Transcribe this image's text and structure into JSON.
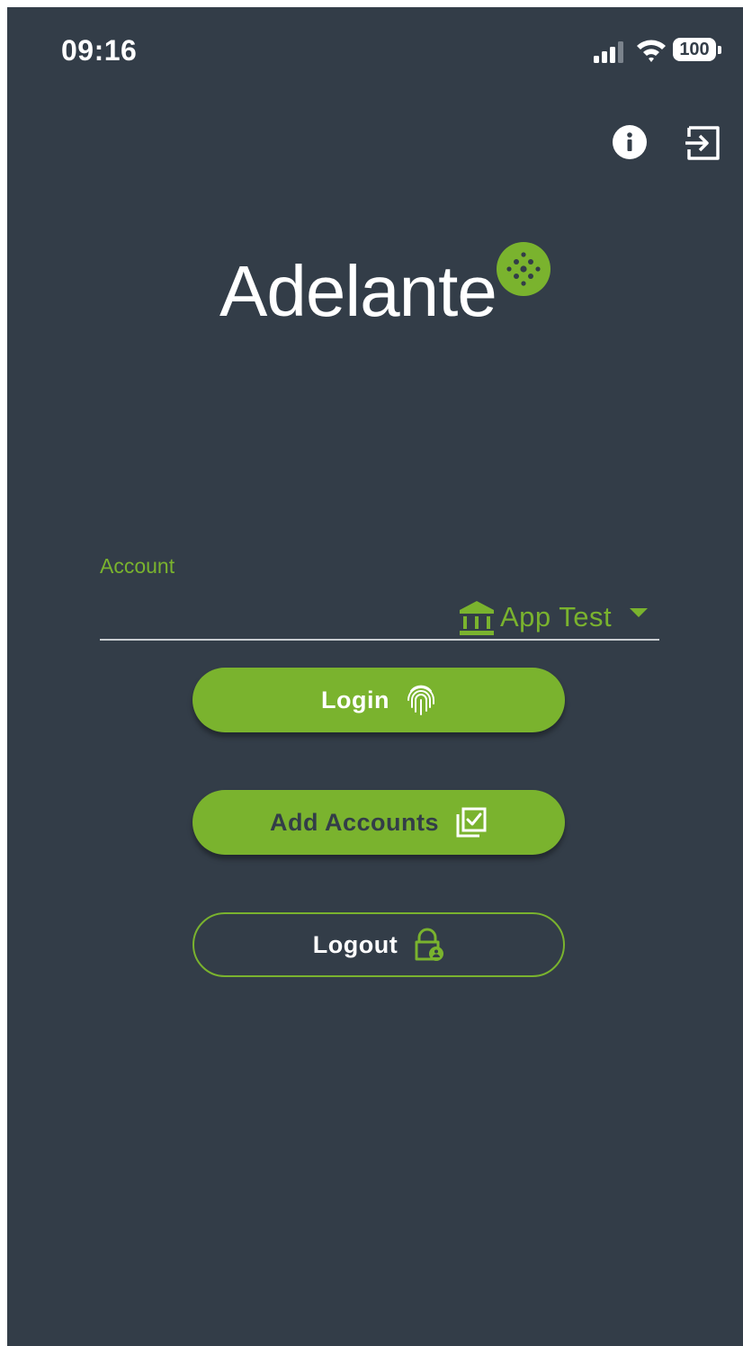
{
  "status_bar": {
    "time": "09:16",
    "battery": "100",
    "icons": [
      "signal-icon",
      "wifi-icon",
      "battery-icon"
    ]
  },
  "header": {
    "icons": [
      "info-icon",
      "exit-icon"
    ]
  },
  "logo": {
    "text": "Adelante",
    "mark_icon": "dotted-circle-icon"
  },
  "account": {
    "label": "Account",
    "selected": "App Test",
    "icon": "bank-icon"
  },
  "buttons": {
    "login": {
      "label": "Login",
      "icon": "fingerprint-icon"
    },
    "add_accounts": {
      "label": "Add Accounts",
      "icon": "checklist-icon"
    },
    "logout": {
      "label": "Logout",
      "icon": "lock-icon"
    }
  },
  "colors": {
    "background": "#333d48",
    "accent": "#7ab32e",
    "text": "#ffffff"
  }
}
